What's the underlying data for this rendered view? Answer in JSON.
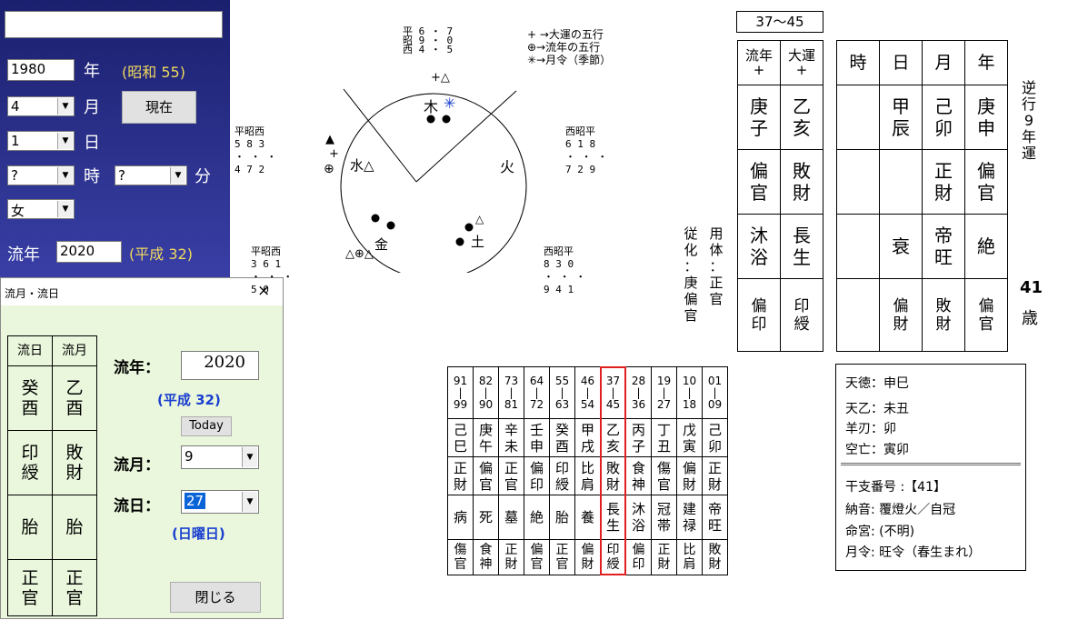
{
  "birth": {
    "year_value": "1980",
    "year_label": "年",
    "era": "(昭和 55)",
    "month_value": "4",
    "month_label": "月",
    "day_value": "1",
    "day_label": "日",
    "hour_value": "?",
    "hour_label": "時",
    "minute_value": "?",
    "minute_label": "分",
    "sex_value": "女",
    "now_button": "現在",
    "ryunen_label": "流年",
    "ryunen_value": "2020",
    "ryunen_era": "(平成 32)"
  },
  "dialog": {
    "title": "流月・流日",
    "close": "×",
    "col1_header": "流日",
    "col2_header": "流月",
    "col1": [
      "癸\n酉",
      "印\n綬",
      "胎",
      "正\n官"
    ],
    "col2": [
      "乙\n酉",
      "敗\n財",
      "胎",
      "正\n官"
    ],
    "year_label": "流年：",
    "year_value": "2020",
    "year_era": "(平成 32)",
    "today_button": "Today",
    "month_label": "流月：",
    "month_value": "9",
    "day_label": "流日：",
    "day_value": "27",
    "weekday": "(日曜日)",
    "close_button": "閉じる"
  },
  "diagram": {
    "top_rows": [
      "平 6 ・ 7",
      "昭 9 ・ 0",
      "西 4 ・ 5"
    ],
    "legend": [
      "+ →大運の五行",
      "⊕→流年の五行",
      "✳→月令（季節）"
    ],
    "top_plus": "+△",
    "wood": "木",
    "wood_star": "✳",
    "fire": "火",
    "water": "水△",
    "metal": "金",
    "earth": "土",
    "left_upper_header": "平昭西",
    "left_upper_nums": "5  8  3",
    "left_upper_nums2": "4  7  2",
    "right_upper_header": "西昭平",
    "right_upper_nums": "6  1  8",
    "right_upper_nums2": "7  2  9",
    "left_lower_header": "平昭西",
    "left_lower_nums": "3  6  1",
    "left_lower_nums2": "5  0",
    "right_lower_header": "西昭平",
    "right_lower_nums": "8  3  0",
    "right_lower_nums2": "9  4  1",
    "marker_triangle": "▲",
    "marker_plus": "+",
    "marker_oplus": "⊕",
    "lower_left_marks": "△⊕△",
    "dots": "・ ・ ・"
  },
  "side": {
    "col1": [
      "従",
      "化",
      "：",
      "庚",
      "偏",
      "官"
    ],
    "col2": [
      "用",
      "体",
      "：",
      "正",
      "官"
    ]
  },
  "daiun_range": "37〜45",
  "table_a": {
    "headers": [
      "流年\n+",
      "大運\n+"
    ],
    "kan": [
      "庚\n子",
      "乙\n亥"
    ],
    "tsuhen": [
      "偏\n官",
      "敗\n財"
    ],
    "unsei": [
      "沐\n浴",
      "長\n生"
    ],
    "zokan": [
      "偏\n印",
      "印\n綬"
    ]
  },
  "table_b": {
    "headers": [
      "時",
      "日",
      "月",
      "年"
    ],
    "kan": [
      "",
      "甲\n辰",
      "己\n卯",
      "庚\n申"
    ],
    "tsuhen": [
      "",
      "",
      "正\n財",
      "偏\n官"
    ],
    "unsei": [
      "",
      "衰",
      "帝\n旺",
      "絶"
    ],
    "zokan": [
      "",
      "偏\n財",
      "敗\n財",
      "偏\n官"
    ]
  },
  "gyakko": "逆行9年運",
  "age": {
    "num": "41",
    "unit": "歳"
  },
  "daiun_table": {
    "ages": [
      [
        "91",
        "99"
      ],
      [
        "82",
        "90"
      ],
      [
        "73",
        "81"
      ],
      [
        "64",
        "72"
      ],
      [
        "55",
        "63"
      ],
      [
        "46",
        "54"
      ],
      [
        "37",
        "45"
      ],
      [
        "28",
        "36"
      ],
      [
        "19",
        "27"
      ],
      [
        "10",
        "18"
      ],
      [
        "01",
        "09"
      ]
    ],
    "kanshi": [
      "己\n巳",
      "庚\n午",
      "辛\n未",
      "壬\n申",
      "癸\n酉",
      "甲\n戌",
      "乙\n亥",
      "丙\n子",
      "丁\n丑",
      "戊\n寅",
      "己\n卯"
    ],
    "tsuhen": [
      "正\n財",
      "偏\n官",
      "正\n官",
      "偏\n印",
      "印\n綬",
      "比\n肩",
      "敗\n財",
      "食\n神",
      "傷\n官",
      "偏\n財",
      "正\n財"
    ],
    "unsei": [
      "病",
      "死",
      "墓",
      "絶",
      "胎",
      "養",
      "長\n生",
      "沐\n浴",
      "冠\n帯",
      "建\n禄",
      "帝\n旺"
    ],
    "zokan": [
      "傷\n官",
      "食\n神",
      "正\n財",
      "偏\n官",
      "正\n官",
      "偏\n財",
      "印\n綬",
      "偏\n印",
      "正\n財",
      "比\n肩",
      "敗\n財"
    ],
    "highlight_color": "#e02020"
  },
  "info": {
    "lines": [
      "天徳：申巳",
      "天乙：未丑",
      "羊刃：卯",
      "空亡：寅卯"
    ],
    "kanshi_no": "干支番号 :【41】",
    "nacchin": "納音: 覆燈火／自冠",
    "meikyu": "命宮: (不明)",
    "getsurei": "月令: 旺令（春生まれ）"
  }
}
